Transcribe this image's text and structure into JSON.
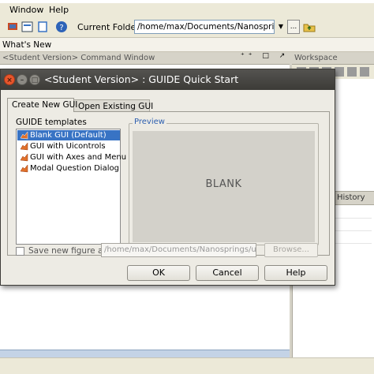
{
  "menubar": {
    "items": [
      "Window",
      "Help"
    ]
  },
  "toolbar": {
    "current_folder_label": "Current Folder:",
    "current_folder_value": "/home/max/Documents/Nanosprings",
    "browse_label": "...",
    "dropdown_glyph": "▼"
  },
  "shortcuts": {
    "whats_new": "What's New"
  },
  "panels": {
    "command_window_title": "<Student Version> Command Window",
    "command_window_controls": "⁺⁺ □ ↗ ×",
    "workspace_title": "Workspace",
    "history_title": "History"
  },
  "dialog": {
    "title": "<Student Version> : GUIDE Quick Start",
    "tabs": [
      {
        "label": "Create New GUI",
        "active": true
      },
      {
        "label": "Open Existing GUI",
        "active": false
      }
    ],
    "templates_label": "GUIDE templates",
    "templates": [
      {
        "label": "Blank GUI (Default)",
        "selected": true
      },
      {
        "label": "GUI with Uicontrols",
        "selected": false
      },
      {
        "label": "GUI with Axes and Menu",
        "selected": false
      },
      {
        "label": "Modal Question Dialog",
        "selected": false
      }
    ],
    "preview_label": "Preview",
    "preview_text": "BLANK",
    "save_checkbox_label": "Save new figure as:",
    "save_checked": false,
    "save_path": "/home/max/Documents/Nanosprings/untitled.fig",
    "browse_button": "Browse...",
    "buttons": {
      "ok": "OK",
      "cancel": "Cancel",
      "help": "Help"
    }
  },
  "colors": {
    "selection": "#3873c4",
    "titlebar": "#3c3b37",
    "close_button": "#e8562c",
    "preview_label": "#2d5fb0"
  }
}
